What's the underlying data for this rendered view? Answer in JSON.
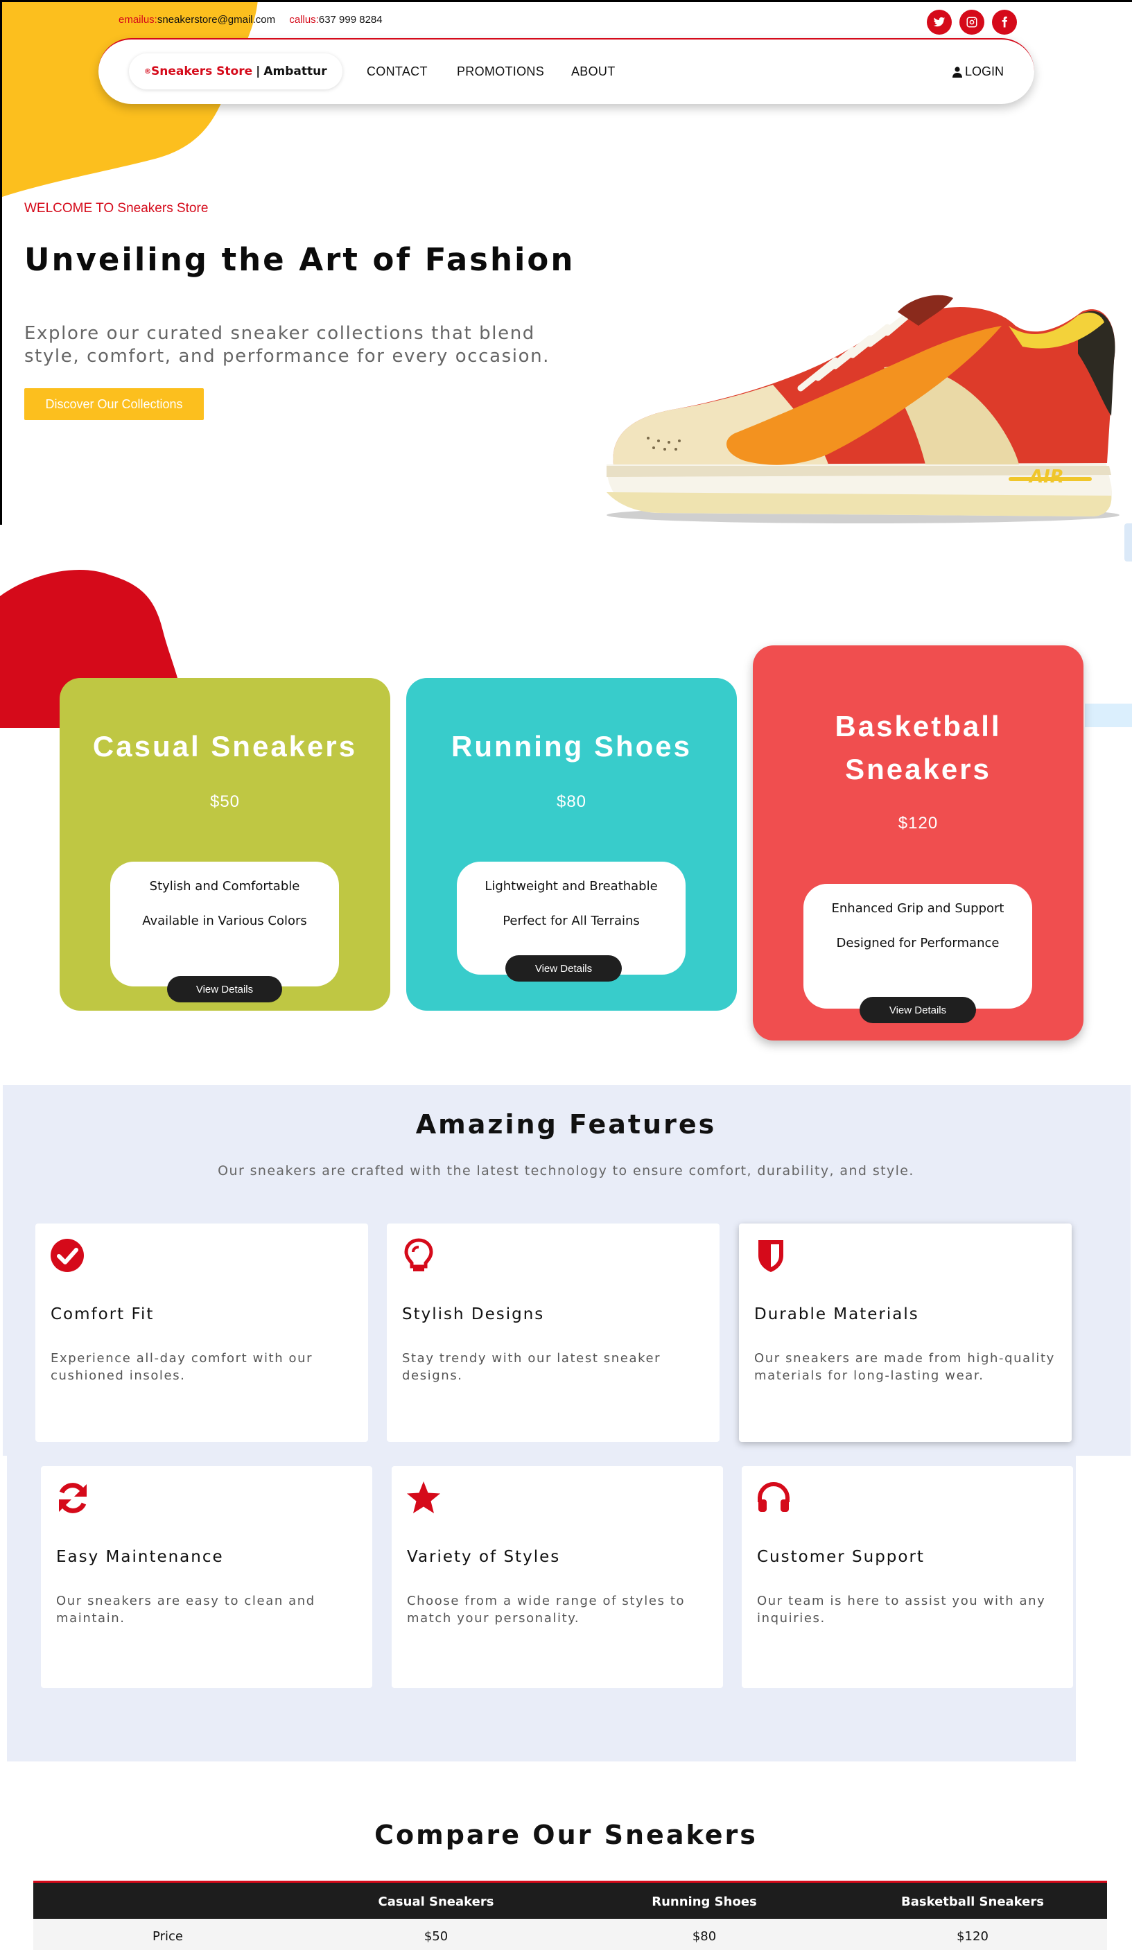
{
  "colors": {
    "accent_red": "#d50a1a",
    "accent_yellow": "#fcbf1e",
    "feature_bg": "#e9edf8"
  },
  "topbar": {
    "email_label": "emailus:",
    "email_value": "sneakerstore@gmail.com",
    "phone_label": "callus:",
    "phone_value": "637 999 8284",
    "social_icons": [
      "twitter-icon",
      "instagram-icon",
      "facebook-icon"
    ]
  },
  "nav": {
    "brand_prefix": "®",
    "brand_name": "Sneakers Store",
    "brand_location": "Ambattur",
    "links": [
      "CONTACT",
      "PROMOTIONS",
      "ABOUT"
    ],
    "login_label": "LOGIN"
  },
  "hero": {
    "welcome": "WELCOME TO Sneakers Store",
    "title": "Unveiling the Art of Fashion",
    "description": "Explore our curated sneaker collections that blend style, comfort, and performance for every occasion.",
    "cta": "Discover Our Collections"
  },
  "products": [
    {
      "title": "Casual Sneakers",
      "price": "$50",
      "features": [
        "Stylish and Comfortable",
        "Available in Various Colors"
      ],
      "button": "View Details",
      "color": "#bfc743"
    },
    {
      "title": "Running Shoes",
      "price": "$80",
      "features": [
        "Lightweight and Breathable",
        "Perfect for All Terrains"
      ],
      "button": "View Details",
      "color": "#38cccb"
    },
    {
      "title": "Basketball Sneakers",
      "price": "$120",
      "features": [
        "Enhanced Grip and Support",
        "Designed for Performance"
      ],
      "button": "View Details",
      "color": "#f04e4f"
    }
  ],
  "features": {
    "title": "Amazing Features",
    "subtitle": "Our sneakers are crafted with the latest technology to ensure comfort, durability, and style.",
    "items": [
      {
        "icon": "check-circle-icon",
        "title": "Comfort Fit",
        "desc": "Experience all-day comfort with our cushioned insoles."
      },
      {
        "icon": "lightbulb-icon",
        "title": "Stylish Designs",
        "desc": "Stay trendy with our latest sneaker designs."
      },
      {
        "icon": "shield-icon",
        "title": "Durable Materials",
        "desc": "Our sneakers are made from high-quality materials for long-lasting wear."
      },
      {
        "icon": "refresh-icon",
        "title": "Easy Maintenance",
        "desc": "Our sneakers are easy to clean and maintain."
      },
      {
        "icon": "star-icon",
        "title": "Variety of Styles",
        "desc": "Choose from a wide range of styles to match your personality."
      },
      {
        "icon": "headset-icon",
        "title": "Customer Support",
        "desc": "Our team is here to assist you with any inquiries."
      }
    ]
  },
  "compare": {
    "title": "Compare Our Sneakers",
    "headers": [
      "",
      "Casual Sneakers",
      "Running Shoes",
      "Basketball Sneakers"
    ],
    "rows": [
      [
        "Price",
        "$50",
        "$80",
        "$120"
      ]
    ]
  }
}
